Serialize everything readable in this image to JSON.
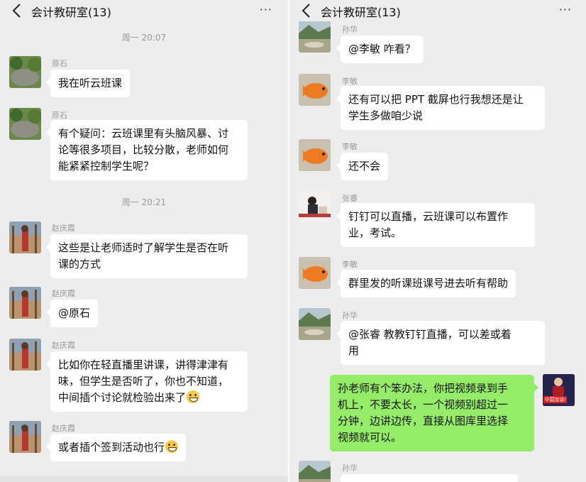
{
  "left": {
    "header": {
      "title": "会计教研室(13)",
      "more": "···"
    },
    "times": [
      "周一 20:07",
      "周一 20:21"
    ],
    "messages": [
      {
        "name": "原石",
        "text": "我在听云班课"
      },
      {
        "name": "原石",
        "lines": [
          "有个疑问：云班课里有头脑风暴、讨",
          "论等很多项目，比较分散，老师如何",
          "能紧紧控制学生呢？"
        ]
      },
      {
        "name": "赵庆霞",
        "lines": [
          "这些是让老师适时了解学生是否在听",
          "课的方式"
        ]
      },
      {
        "name": "赵庆霞",
        "text": "@原石"
      },
      {
        "name": "赵庆霞",
        "lines": [
          "比如你在轻直播里讲课，讲得津津有",
          "味，但学生是否听了，你也不知道，",
          "中间插个讨论就检验出来了"
        ]
      },
      {
        "name": "赵庆霞",
        "text": "或者插个签到活动也行"
      }
    ]
  },
  "right": {
    "header": {
      "title": "会计教研室(13)",
      "more": "···"
    },
    "messages": [
      {
        "name": "孙华",
        "text": "@李敏  咋看？"
      },
      {
        "name": "李敏",
        "lines": [
          "还有可以把 PPT 截屏也行我想还是让",
          "学生多做咱少说"
        ]
      },
      {
        "name": "李敏",
        "text": "还不会"
      },
      {
        "name": "张睿",
        "lines": [
          "钉钉可以直播，云班课可以布置作",
          "业，考试。"
        ]
      },
      {
        "name": "李敏",
        "text": "群里发的听课班课号进去听有帮助"
      },
      {
        "name": "孙华",
        "lines": [
          "@张睿  教教钉钉直播，可以差或着",
          "用"
        ]
      },
      {
        "self": true,
        "lines": [
          "孙老师有个笨办法，你把视频录到手",
          "机上，不要太长，一个视频别超过一",
          "分钟，边讲边传，直接从图库里选择",
          "视频就可以。"
        ],
        "avatar_badge": "中国加油!"
      },
      {
        "name": "孙华"
      }
    ]
  },
  "colors": {
    "self_bubble": "#95ec69",
    "other_bubble": "#ffffff",
    "background": "#ededed"
  },
  "icons": [
    "back-arrow-icon",
    "more-icon",
    "grin-emoji-icon"
  ]
}
